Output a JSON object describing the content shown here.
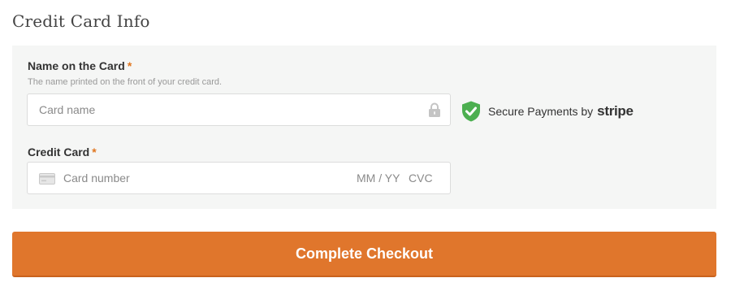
{
  "section": {
    "title": "Credit Card Info"
  },
  "name_field": {
    "label": "Name on the Card",
    "required_mark": "*",
    "hint": "The name printed on the front of your credit card.",
    "placeholder": "Card name",
    "icon": "lock-icon"
  },
  "secure": {
    "text": "Secure Payments by",
    "brand": "stripe",
    "icon": "shield-check-icon",
    "icon_color": "#4caf50"
  },
  "card_field": {
    "label": "Credit Card",
    "required_mark": "*",
    "placeholder": "Card number",
    "expiry_placeholder": "MM / YY",
    "cvc_placeholder": "CVC",
    "icon": "credit-card-icon"
  },
  "checkout": {
    "label": "Complete Checkout",
    "color": "#e0762c"
  }
}
